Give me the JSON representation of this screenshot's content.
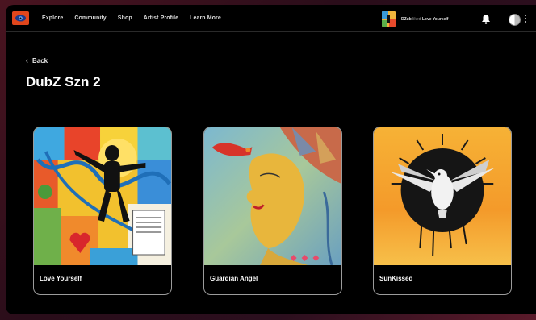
{
  "nav": {
    "items": [
      "Explore",
      "Community",
      "Shop",
      "Artist Profile",
      "Learn More"
    ]
  },
  "now_playing": {
    "artist": "DZub",
    "verb": "liked",
    "title": "Love Yourself"
  },
  "icons": {
    "logo": "eye-logo-icon",
    "bell": "bell-icon",
    "avatar": "user-avatar",
    "menu": "vertical-dots-icon",
    "back": "chevron-left-icon"
  },
  "page": {
    "back_label": "Back",
    "title": "DubZ Szn 2"
  },
  "cards": [
    {
      "title": "Love Yourself"
    },
    {
      "title": "Guardian Angel"
    },
    {
      "title": "SunKissed"
    }
  ],
  "colors": {
    "accent": "#e0461c",
    "background": "#000000"
  }
}
